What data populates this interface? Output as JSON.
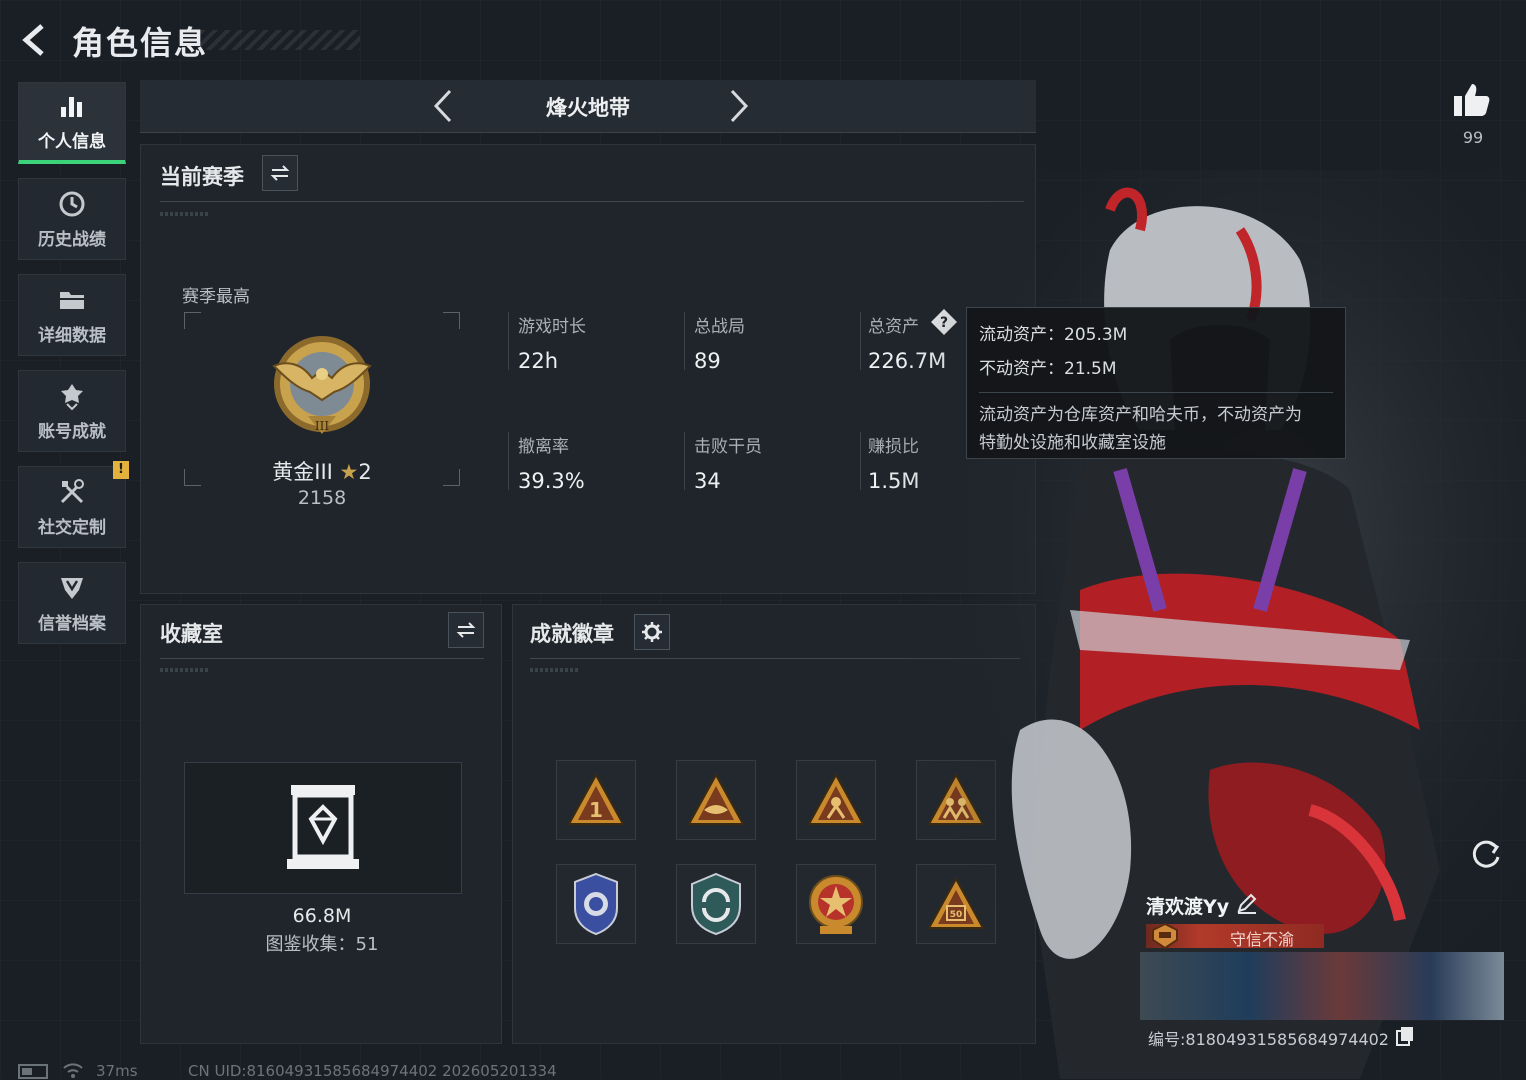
{
  "header": {
    "title": "角色信息"
  },
  "sidebar": {
    "items": [
      {
        "label": "个人信息",
        "icon": "bar-chart-icon"
      },
      {
        "label": "历史战绩",
        "icon": "history-icon"
      },
      {
        "label": "详细数据",
        "icon": "folder-icon"
      },
      {
        "label": "账号成就",
        "icon": "achievement-icon"
      },
      {
        "label": "社交定制",
        "icon": "tools-icon",
        "badge": "!"
      },
      {
        "label": "信誉档案",
        "icon": "shield-icon"
      }
    ]
  },
  "mode": {
    "name": "烽火地带"
  },
  "season": {
    "title": "当前赛季",
    "best_label": "赛季最高",
    "rank_name": "黄金III",
    "rank_stars": "2",
    "rank_score": "2158",
    "stats": [
      {
        "label": "游戏时长",
        "value": "22h"
      },
      {
        "label": "总战局",
        "value": "89"
      },
      {
        "label": "总资产",
        "value": "226.7M"
      },
      {
        "label": "撤离率",
        "value": "39.3%"
      },
      {
        "label": "击败干员",
        "value": "34"
      },
      {
        "label": "赚损比",
        "value": "1.5M"
      }
    ]
  },
  "tooltip": {
    "liquid": "流动资产：205.3M",
    "fixed": "不动资产：21.5M",
    "desc_1": "流动资产为仓库资产和哈夫币，不动资产为",
    "desc_2": "特勤处设施和收藏室设施"
  },
  "collection": {
    "title": "收藏室",
    "value": "66.8M",
    "count": "图鉴收集：51"
  },
  "achievements": {
    "title": "成就徽章",
    "badges": [
      "badge-1",
      "badge-2",
      "badge-3",
      "badge-4",
      "badge-5",
      "badge-6",
      "badge-7",
      "badge-8"
    ]
  },
  "profile": {
    "likes": "99",
    "player_name": "清欢渡Yy",
    "credit": "守信不渝",
    "player_id": "编号:8180493158568497440​2"
  },
  "footer": {
    "ping": "37ms",
    "uid": "CN UID:8160493158568497440​2 202605201334"
  },
  "colors": {
    "accent_green": "#3ad37a",
    "warning_yellow": "#e3b23c",
    "credit_red": "#b23a2a",
    "gold": "#c9a24e"
  }
}
